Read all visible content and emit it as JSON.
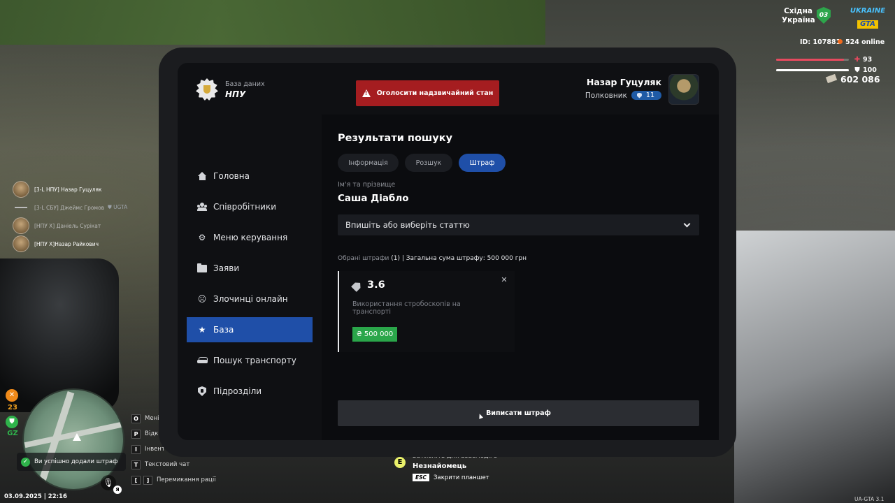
{
  "hud": {
    "region_line1": "Східна",
    "region_line2": "Україна",
    "region_code": "03",
    "logo_line1": "UKRAINE",
    "logo_line2": "GTA",
    "player_id": "ID: 107881",
    "online": "524 online",
    "health": 93,
    "armor": 100,
    "money": "602 086",
    "health_color": "#e84a5f",
    "armor_color": "#ffffff"
  },
  "players": [
    {
      "name": "[3-L НПУ] Назар Гуцуляк",
      "extra": ""
    },
    {
      "name": "[3-L СБУ] Джеймс Громов",
      "extra": "UGTA"
    },
    {
      "name": "[НПУ X] Даніель Сурікат",
      "extra": ""
    },
    {
      "name": "[НПУ X]Назар Райкович",
      "extra": ""
    }
  ],
  "minimap": {
    "badge_value": "23",
    "zone_label": "GZ"
  },
  "keybinds": [
    {
      "keys": [
        "O"
      ],
      "label": "Мені"
    },
    {
      "keys": [
        "P"
      ],
      "label": "Відк"
    },
    {
      "keys": [
        "I"
      ],
      "label": "Інвент"
    },
    {
      "keys": [
        "T"
      ],
      "label": "Текстовий чат"
    },
    {
      "keys": [
        "[",
        "]"
      ],
      "label": "Перемикання рації"
    }
  ],
  "toast": "Ви успішно додали штраф",
  "mic_lang": "Я",
  "datetime": "03.09.2025 | 22:16",
  "interact": {
    "key": "E",
    "line1": "Затисніть для взаємодії з",
    "line2": "Незнайомець",
    "esc_key": "ESC",
    "esc_label": "Закрити планшет"
  },
  "version": "UA-GTA 3.1",
  "tablet": {
    "brand_small": "База даних",
    "brand_big": "НПУ",
    "alarm_label": "Оголосити надзвичайний стан",
    "user": {
      "name": "Назар Гуцуляк",
      "rank": "Полковник",
      "level": "11"
    },
    "nav": [
      {
        "label": "Головна",
        "icon": "home-icon",
        "active": false
      },
      {
        "label": "Співробітники",
        "icon": "users-icon",
        "active": false
      },
      {
        "label": "Меню керування",
        "icon": "gear-icon",
        "active": false
      },
      {
        "label": "Заяви",
        "icon": "folder-icon",
        "active": false
      },
      {
        "label": "Злочинці онлайн",
        "icon": "mask-icon",
        "active": false
      },
      {
        "label": "База",
        "icon": "star-icon",
        "active": true
      },
      {
        "label": "Пошук транспорту",
        "icon": "car-icon",
        "active": false
      },
      {
        "label": "Підрозділи",
        "icon": "shield-icon",
        "active": false
      }
    ],
    "title": "Результати пошуку",
    "tabs": [
      {
        "label": "Інформація",
        "active": false
      },
      {
        "label": "Розшук",
        "active": false
      },
      {
        "label": "Штраф",
        "active": true
      }
    ],
    "name_label": "Ім'я та прізвище",
    "name_value": "Саша Діабло",
    "article_select": "Впишіть або виберіть статтю",
    "summary_muted": "Обрані штрафи",
    "summary_rest": " (1) | Загальна сума штрафу: 500 000 грн",
    "fine": {
      "code": "3.6",
      "description": "Використання стробоскопів на транспорті",
      "amount": "₴ 500 000"
    },
    "submit_label": "Виписати штраф",
    "accent": "#1f4fa8",
    "danger": "#a51d20",
    "success": "#2aa64a"
  }
}
